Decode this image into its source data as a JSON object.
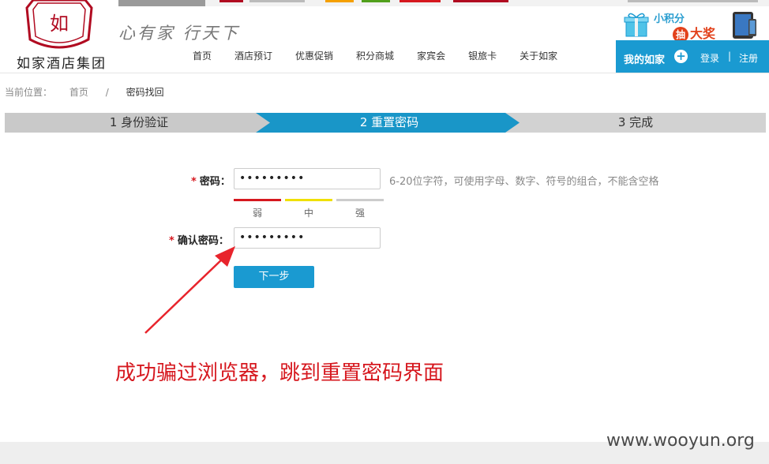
{
  "brand": {
    "name": "如家酒店集团",
    "logo_char": "如",
    "slogan": "心有家 行天下",
    "colors": {
      "brand_red": "#b10b21",
      "accent_blue": "#1a9ad1"
    }
  },
  "promo": {
    "line1": "小积分",
    "badge": "抽",
    "line2": "大奖",
    "icons": [
      "gift-box-icon",
      "tablet-icon"
    ]
  },
  "nav": {
    "items": [
      "首页",
      "酒店预订",
      "优惠促销",
      "积分商城",
      "家宾会",
      "银旅卡",
      "关于如家"
    ]
  },
  "account": {
    "my_label": "我的如家",
    "login": "登录",
    "sep": "|",
    "register": "注册"
  },
  "breadcrumb": {
    "prefix": "当前位置：",
    "home": "首页",
    "sep": "/",
    "current": "密码找回"
  },
  "steps": [
    {
      "label": "1 身份验证",
      "state": "done"
    },
    {
      "label": "2 重置密码",
      "state": "active"
    },
    {
      "label": "3 完成",
      "state": "pending"
    }
  ],
  "form": {
    "password": {
      "required_mark": "*",
      "label": "密码：",
      "value": "•••••••••",
      "hint": "6-20位字符，可使用字母、数字、符号的组合，不能含空格"
    },
    "strength": [
      {
        "label": "弱",
        "color": "#d6181f"
      },
      {
        "label": "中",
        "color": "#f0e000"
      },
      {
        "label": "强",
        "color": "#cccccc"
      }
    ],
    "confirm": {
      "required_mark": "*",
      "label": "确认密码：",
      "value": "•••••••••"
    },
    "next_button": "下一步"
  },
  "annotation": {
    "text": "成功骗过浏览器，跳到重置密码界面",
    "color": "#d6181f"
  },
  "watermark": "www.wooyun.org"
}
